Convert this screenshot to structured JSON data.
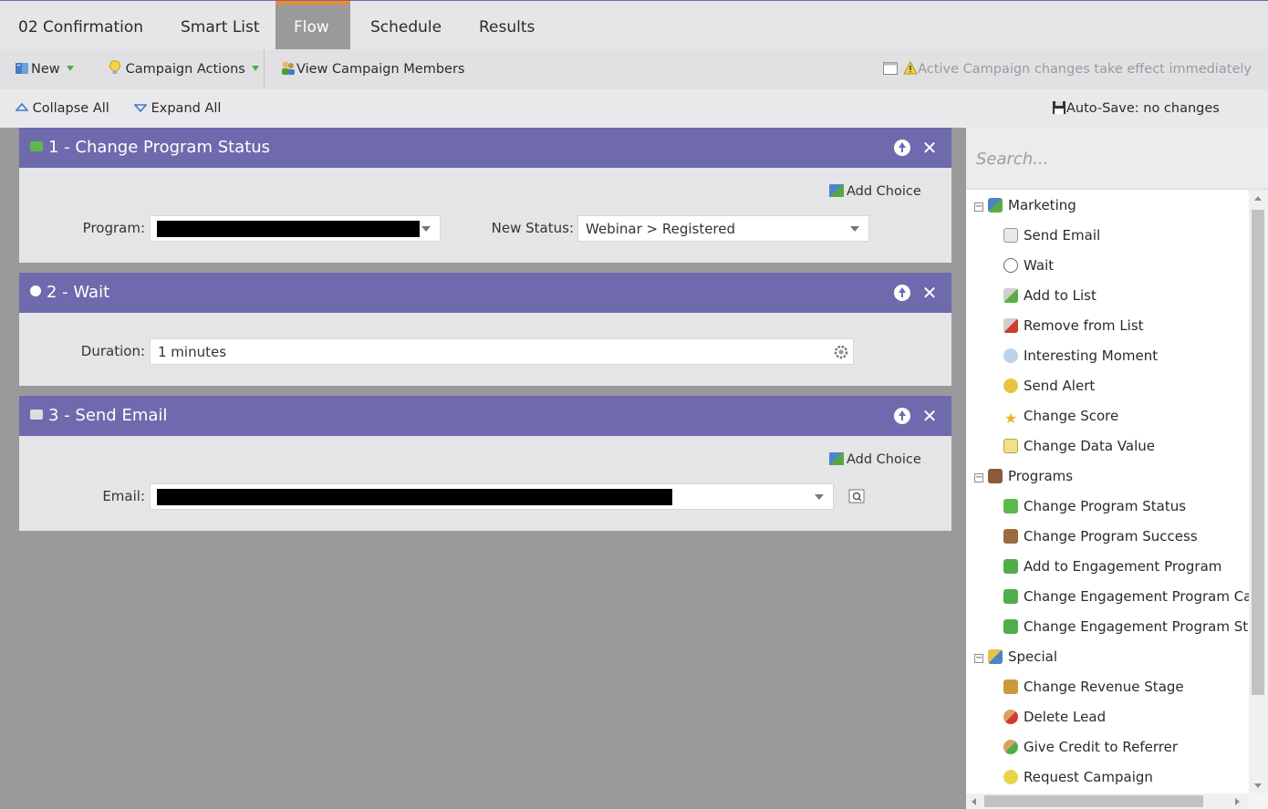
{
  "tabs": [
    "02 Confirmation",
    "Smart List",
    "Flow",
    "Schedule",
    "Results"
  ],
  "active_tab": "Flow",
  "toolbar": {
    "new_label": "New",
    "campaign_actions_label": "Campaign Actions",
    "view_members_label": "View Campaign Members",
    "notice_label": "Active Campaign  changes take effect immediately"
  },
  "actionbar": {
    "collapse_label": "Collapse All",
    "expand_label": "Expand All",
    "autosave_label": "Auto-Save: no changes"
  },
  "steps": [
    {
      "title": "1 - Change Program Status",
      "add_choice": "Add Choice",
      "program_label": "Program:",
      "program_value": "",
      "status_label": "New Status:",
      "status_value": "Webinar > Registered"
    },
    {
      "title": "2 - Wait",
      "duration_label": "Duration:",
      "duration_value": "1 minutes"
    },
    {
      "title": "3 - Send Email",
      "add_choice": "Add Choice",
      "email_label": "Email:",
      "email_value": ""
    }
  ],
  "palette": {
    "search_placeholder": "Search...",
    "groups": [
      {
        "label": "Marketing",
        "items": [
          "Send Email",
          "Wait",
          "Add to List",
          "Remove from List",
          "Interesting Moment",
          "Send Alert",
          "Change Score",
          "Change Data Value"
        ]
      },
      {
        "label": "Programs",
        "items": [
          "Change Program Status",
          "Change Program Success",
          "Add to Engagement Program",
          "Change Engagement Program Cad",
          "Change Engagement Program Stre"
        ]
      },
      {
        "label": "Special",
        "items": [
          "Change Revenue Stage",
          "Delete Lead",
          "Give Credit to Referrer",
          "Request Campaign"
        ]
      }
    ]
  },
  "colors": {
    "header_purple": "#6e6aad",
    "tab_accent": "#f08a2b",
    "canvas_gray": "#9a9a9d"
  }
}
